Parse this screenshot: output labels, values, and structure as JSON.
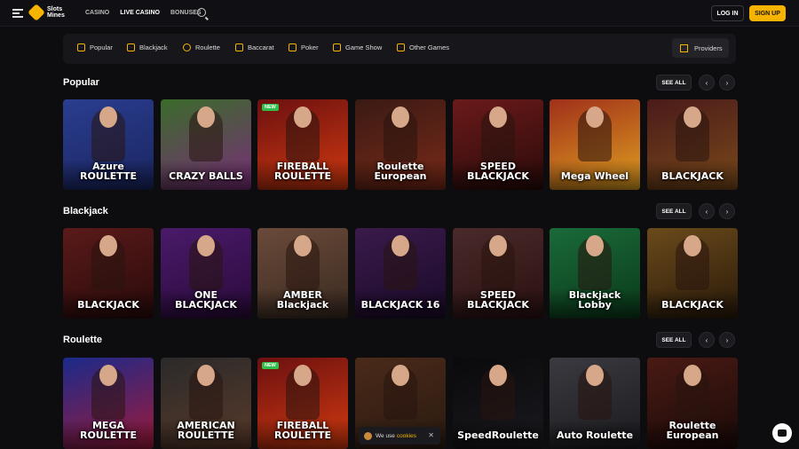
{
  "header": {
    "logo_line1": "Slots",
    "logo_line2": "Mines",
    "nav": [
      "CASINO",
      "LIVE CASINO",
      "BONUSES"
    ],
    "login": "LOG IN",
    "signup": "SIGN UP"
  },
  "categories": [
    "Popular",
    "Blackjack",
    "Roulette",
    "Baccarat",
    "Poker",
    "Game Show",
    "Other Games"
  ],
  "providers": "Providers",
  "sections": [
    {
      "title": "Popular",
      "see_all": "SEE ALL",
      "tiles": [
        {
          "label": "Azure ROULETTE",
          "bg": "#2a3d8f",
          "accent": "#1a2560"
        },
        {
          "label": "CRAZY BALLS",
          "bg": "#3a6b2a",
          "accent": "#7a2d7a"
        },
        {
          "label": "FIREBALL ROULETTE",
          "bg": "#6b1010",
          "accent": "#d23a10",
          "badge": "NEW"
        },
        {
          "label": "Roulette European",
          "bg": "#3a1a14",
          "accent": "#7a2a18"
        },
        {
          "label": "SPEED BLACKJACK",
          "bg": "#6b1a1a",
          "accent": "#2a0a0a"
        },
        {
          "label": "Mega Wheel",
          "bg": "#a0301a",
          "accent": "#e0a020"
        },
        {
          "label": "BLACKJACK",
          "bg": "#4a1a1a",
          "accent": "#7a4a1a"
        }
      ]
    },
    {
      "title": "Blackjack",
      "see_all": "SEE ALL",
      "tiles": [
        {
          "label": "BLACKJACK",
          "bg": "#5a1a1a",
          "accent": "#2a0a0a"
        },
        {
          "label": "ONE BLACKJACK",
          "bg": "#4a1a6a",
          "accent": "#2a0a3a"
        },
        {
          "label": "AMBER Blackjack",
          "bg": "#6a4a3a",
          "accent": "#3a2a20"
        },
        {
          "label": "BLACKJACK 16",
          "bg": "#3a1a4a",
          "accent": "#1a0a2a"
        },
        {
          "label": "SPEED BLACKJACK",
          "bg": "#4a2a2a",
          "accent": "#2a1010"
        },
        {
          "label": "Blackjack Lobby",
          "bg": "#1a6a3a",
          "accent": "#0a3a1a"
        },
        {
          "label": "BLACKJACK",
          "bg": "#6a4a1a",
          "accent": "#2a1a0a"
        }
      ]
    },
    {
      "title": "Roulette",
      "see_all": "SEE ALL",
      "tiles": [
        {
          "label": "MEGA ROULETTE",
          "bg": "#1a2a8a",
          "accent": "#a01a3a"
        },
        {
          "label": "AMERICAN ROULETTE",
          "bg": "#2a2a2a",
          "accent": "#5a3a2a"
        },
        {
          "label": "FIREBALL ROULETTE",
          "bg": "#6b1010",
          "accent": "#d23a10",
          "badge": "NEW"
        },
        {
          "label": "",
          "bg": "#4a2a1a",
          "accent": "#2a1a10"
        },
        {
          "label": "SpeedRoulette",
          "bg": "#0a0a0c",
          "accent": "#1a1a1f"
        },
        {
          "label": "Auto Roulette",
          "bg": "#3a3a40",
          "accent": "#1a1a1f"
        },
        {
          "label": "Roulette European",
          "bg": "#4a1a14",
          "accent": "#1a0a08"
        }
      ]
    }
  ],
  "cookie": {
    "text": "We use",
    "link": "cookies",
    "close": "✕"
  }
}
